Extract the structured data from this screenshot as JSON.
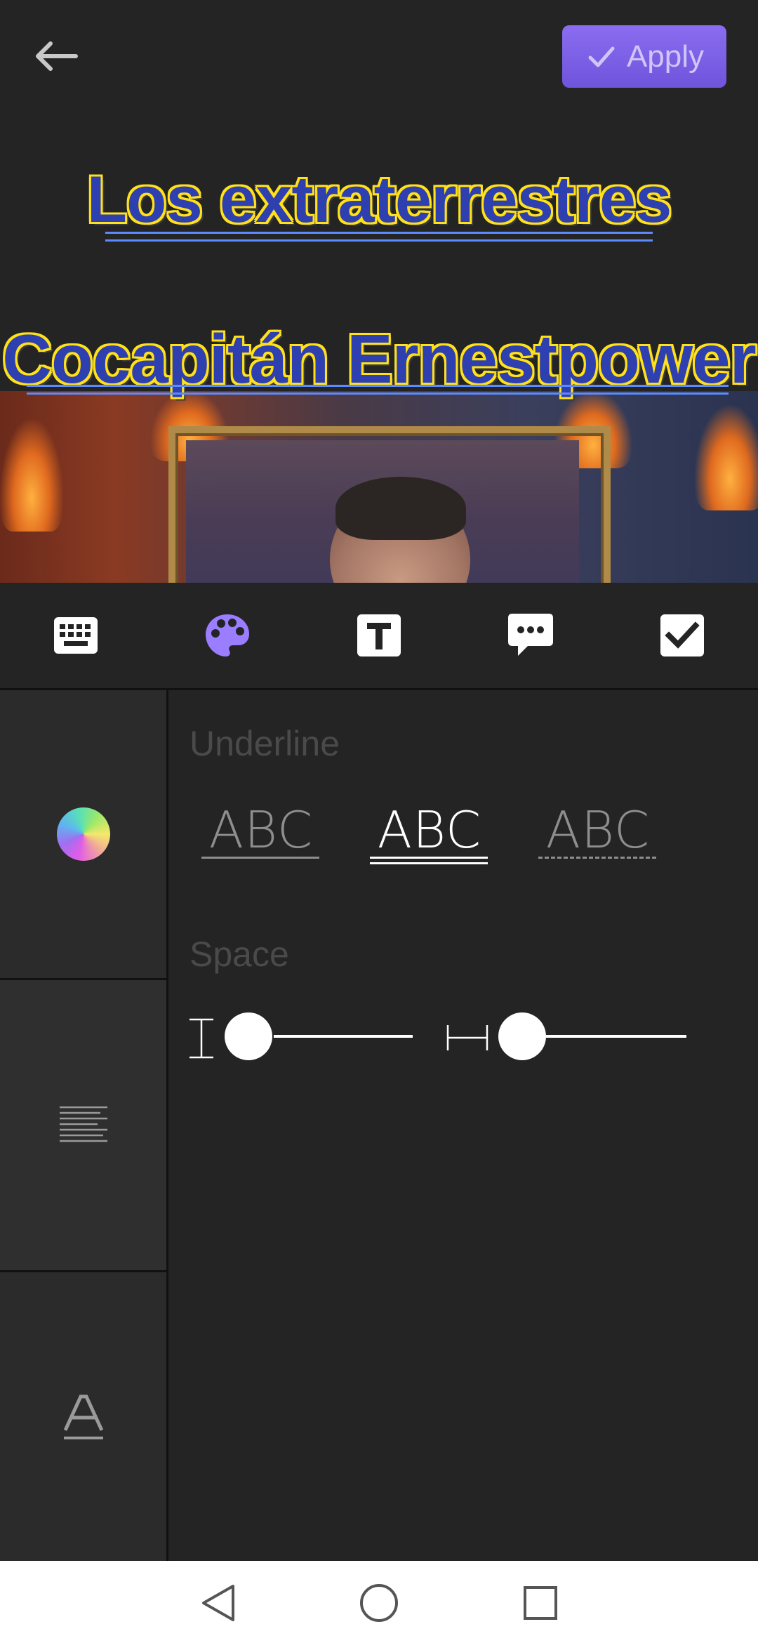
{
  "header": {
    "apply_label": "Apply"
  },
  "preview": {
    "title_line_1": "Los extraterrestres",
    "title_line_2": "Cocapitán  Ernestpower"
  },
  "toolbar": {
    "tools": [
      "keyboard-icon",
      "palette-icon",
      "text-format-icon",
      "speech-bubble-icon",
      "checkbox-icon"
    ],
    "active_tool": "palette-icon"
  },
  "sidebar": {
    "items": [
      "color-wheel-icon",
      "align-lines-icon",
      "underline-a-icon"
    ]
  },
  "underline": {
    "label": "Underline",
    "options": [
      {
        "text": "ABC",
        "style": "single"
      },
      {
        "text": "ABC",
        "style": "double"
      },
      {
        "text": "ABC",
        "style": "dashed"
      }
    ],
    "selected_index": 1
  },
  "space": {
    "label": "Space",
    "line_spacing_value": 0,
    "letter_spacing_value": 0
  },
  "colors": {
    "accent": "#7a5ee8",
    "background": "#242424",
    "sidebar": "#2b2b2b",
    "title_fill": "#2e3fb0",
    "title_outline": "#ffe11a"
  }
}
